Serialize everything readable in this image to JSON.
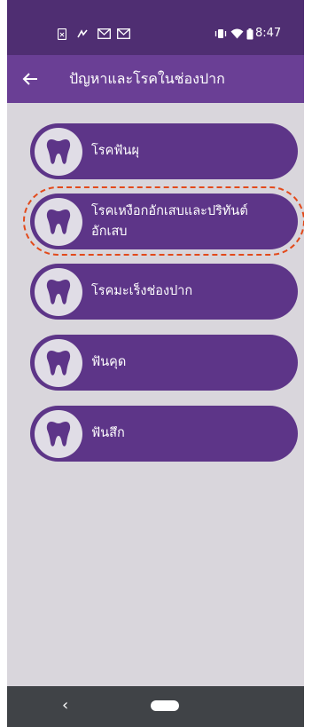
{
  "status_bar": {
    "time": "8:47",
    "left_icons": [
      "sim-card-icon",
      "sync-icon",
      "gmail-icon",
      "gmail-icon"
    ],
    "right_icons": [
      "vibrate-icon",
      "wifi-icon",
      "battery-icon"
    ]
  },
  "app_bar": {
    "back_icon": "arrow-left-icon",
    "title": "ปัญหาและโรคในช่องปาก"
  },
  "menu": {
    "items": [
      {
        "label": "โรคฟันผุ",
        "icon": "tooth-icon"
      },
      {
        "label_line1": "โรคเหงือกอักเสบและปริทันต์",
        "label_line2": "อักเสบ",
        "icon": "tooth-icon",
        "highlighted": true
      },
      {
        "label": "โรคมะเร็งช่องปาก",
        "icon": "tooth-icon"
      },
      {
        "label": "ฟันคุด",
        "icon": "tooth-icon"
      },
      {
        "label": "ฟันสึก",
        "icon": "tooth-icon"
      }
    ]
  },
  "nav_bar": {
    "back_icon": "nav-back-icon",
    "home_icon": "nav-home-pill-icon"
  },
  "colors": {
    "status_bar": "#4f2e72",
    "app_bar": "#6a3f95",
    "menu_item": "#5d3588",
    "background": "#d9d6dc",
    "highlight": "#e24a1b"
  }
}
